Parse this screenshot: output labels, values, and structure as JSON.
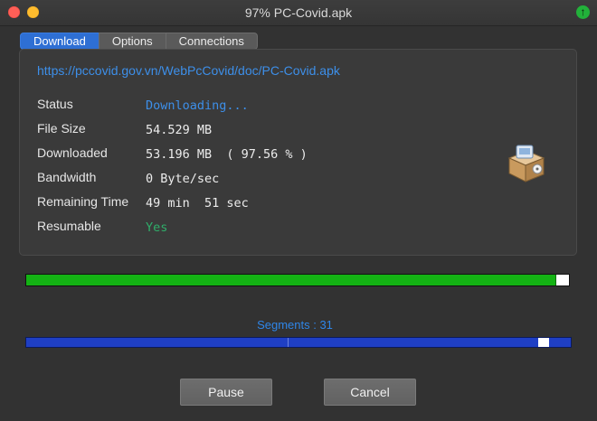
{
  "window": {
    "title": "97%  PC-Covid.apk"
  },
  "tabs": [
    {
      "label": "Download",
      "active": true
    },
    {
      "label": "Options",
      "active": false
    },
    {
      "label": "Connections",
      "active": false
    }
  ],
  "info": {
    "url": "https://pccovid.gov.vn/WebPcCovid/doc/PC-Covid.apk",
    "rows": [
      {
        "label": "Status",
        "value": "Downloading..."
      },
      {
        "label": "File Size",
        "value": "54.529 MB"
      },
      {
        "label": "Downloaded",
        "value": "53.196 MB  ( 97.56 % )"
      },
      {
        "label": "Bandwidth",
        "value": "0 Byte/sec"
      },
      {
        "label": "Remaining Time",
        "value": "49 min  51 sec"
      },
      {
        "label": "Resumable",
        "value": "Yes"
      }
    ]
  },
  "progress": {
    "fraction": 0.9756
  },
  "segments": {
    "label": "Segments : 31",
    "marker_fraction": 0.94,
    "divider_fraction": 0.48
  },
  "buttons": {
    "pause": "Pause",
    "cancel": "Cancel"
  },
  "icons": {
    "update": "arrow-up-icon",
    "package": "package-box-icon"
  },
  "colors": {
    "accent": "#3d8fe9",
    "progress": "#14b214",
    "segments": "#1f3fc4",
    "status_ok": "#2fae6a"
  }
}
